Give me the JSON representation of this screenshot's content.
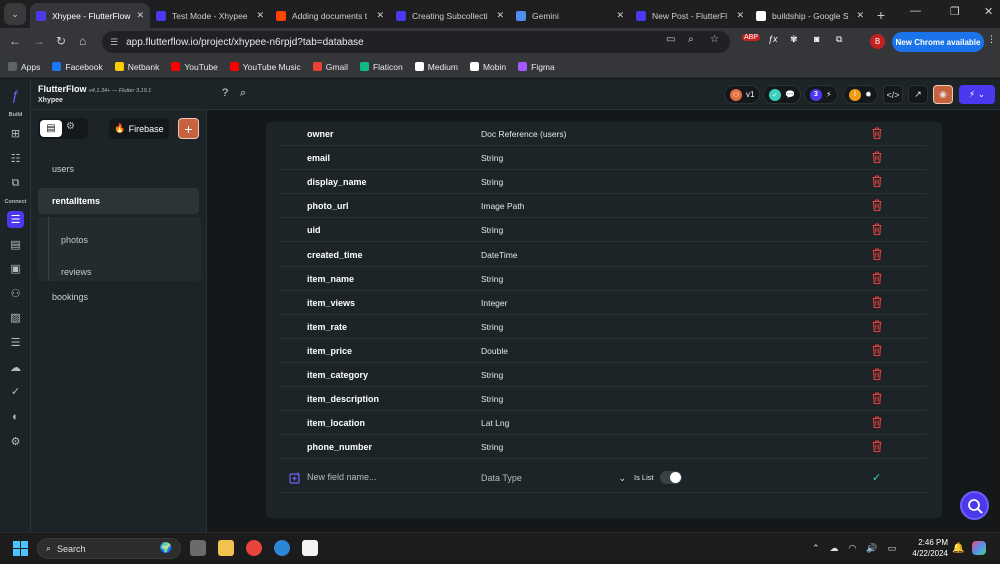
{
  "browser": {
    "tabs": [
      {
        "title": "Xhypee - FlutterFlow",
        "icon": "flutterflow-icon",
        "color": "#4b39ef",
        "active": true
      },
      {
        "title": "Test Mode - Xhypee",
        "icon": "flutterflow-icon",
        "color": "#4b39ef",
        "active": false
      },
      {
        "title": "Adding documents t",
        "icon": "reddit-icon",
        "color": "#ff4500",
        "active": false
      },
      {
        "title": "Creating Subcollecti",
        "icon": "flutterflow-icon",
        "color": "#4b39ef",
        "active": false
      },
      {
        "title": "Gemini",
        "icon": "gemini-icon",
        "color": "#4f8df5",
        "active": false
      },
      {
        "title": "New Post - FlutterFl",
        "icon": "flutterflow-icon",
        "color": "#4b39ef",
        "active": false
      },
      {
        "title": "buildship - Google S",
        "icon": "google-icon",
        "color": "#ffffff",
        "active": false
      }
    ],
    "url": "app.flutterflow.io/project/xhypee-n6rpjd?tab=database",
    "new_chrome_label": "New Chrome available",
    "profile_initial": "B",
    "bookmarks": [
      {
        "label": "Apps",
        "color": "#5f6368"
      },
      {
        "label": "Facebook",
        "color": "#1877f2"
      },
      {
        "label": "Netbank",
        "color": "#ffcc00"
      },
      {
        "label": "YouTube",
        "color": "#ff0000"
      },
      {
        "label": "YouTube Music",
        "color": "#ff0000"
      },
      {
        "label": "Gmail",
        "color": "#ea4335"
      },
      {
        "label": "Flaticon",
        "color": "#10bb81"
      },
      {
        "label": "Medium",
        "color": "#ffffff"
      },
      {
        "label": "Mobin",
        "color": "#ffffff"
      },
      {
        "label": "Figma",
        "color": "#a259ff"
      }
    ]
  },
  "app": {
    "brand": "FlutterFlow",
    "version": "v4.1.34+ — Flutter 3.19.1",
    "project_name": "Xhypee",
    "rail": {
      "build_label": "Build",
      "connect_label": "Connect"
    },
    "header": {
      "version_tag": "v1",
      "badge_count": "3"
    },
    "panel": {
      "firebase_label": "Firebase",
      "collections": [
        "users",
        "rentalItems",
        "bookings"
      ],
      "subcollections": [
        "photos",
        "reviews"
      ],
      "active_collection": "rentalItems"
    },
    "fields": [
      {
        "name": "owner",
        "type": "Doc Reference (users)"
      },
      {
        "name": "email",
        "type": "String"
      },
      {
        "name": "display_name",
        "type": "String"
      },
      {
        "name": "photo_url",
        "type": "Image Path"
      },
      {
        "name": "uid",
        "type": "String"
      },
      {
        "name": "created_time",
        "type": "DateTime"
      },
      {
        "name": "item_name",
        "type": "String"
      },
      {
        "name": "item_views",
        "type": "Integer"
      },
      {
        "name": "item_rate",
        "type": "String"
      },
      {
        "name": "item_price",
        "type": "Double"
      },
      {
        "name": "item_category",
        "type": "String"
      },
      {
        "name": "item_description",
        "type": "String"
      },
      {
        "name": "item_location",
        "type": "Lat Lng"
      },
      {
        "name": "phone_number",
        "type": "String"
      }
    ],
    "new_field": {
      "placeholder": "New field name...",
      "data_type_placeholder": "Data Type",
      "is_list_label": "Is List",
      "is_list": false
    },
    "colors": {
      "accent": "#4b39ef",
      "delete": "#e0403d",
      "confirm": "#39d2c0"
    }
  },
  "taskbar": {
    "search_label": "Search",
    "time": "2:46 PM",
    "date": "4/22/2024"
  }
}
